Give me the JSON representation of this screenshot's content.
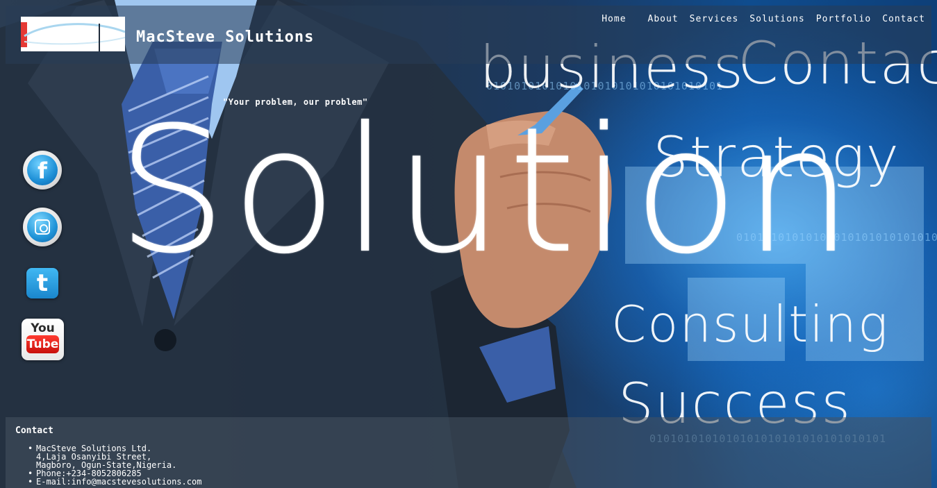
{
  "header": {
    "site_title": "MacSteve Solutions",
    "logo_icon": "macsteve-logo-icon"
  },
  "nav": {
    "items": [
      {
        "label": "Home"
      },
      {
        "label": "About"
      },
      {
        "label": "Services"
      },
      {
        "label": "Solutions"
      },
      {
        "label": "Portfolio"
      },
      {
        "label": "Contact"
      }
    ]
  },
  "hero": {
    "tagline": "\"Your problem, our problem\"",
    "headline": "Solution",
    "words": {
      "business": "business",
      "contact": "Contact",
      "strategy": "Strategy",
      "consulting": "Consulting",
      "success": "Success"
    },
    "binary": "0101010101010101010101010101010101"
  },
  "social": {
    "facebook": {
      "icon": "facebook-icon",
      "glyph": "f"
    },
    "instagram": {
      "icon": "instagram-icon"
    },
    "twitter": {
      "icon": "twitter-icon",
      "glyph": "t"
    },
    "youtube": {
      "icon": "youtube-icon",
      "top_text": "You",
      "bottom_text": "Tube"
    }
  },
  "contact": {
    "title": "Contact",
    "lines": [
      "MacSteve Solutions Ltd.\n4,Laja Osanyibi Street,\nMagboro, Ogun-State,Nigeria.",
      "Phone:+234-8052806285",
      "E-mail:info@macstevesolutions.com"
    ]
  },
  "colors": {
    "accent_red": "#e53935",
    "brand_blue": "#1d8fd6"
  }
}
